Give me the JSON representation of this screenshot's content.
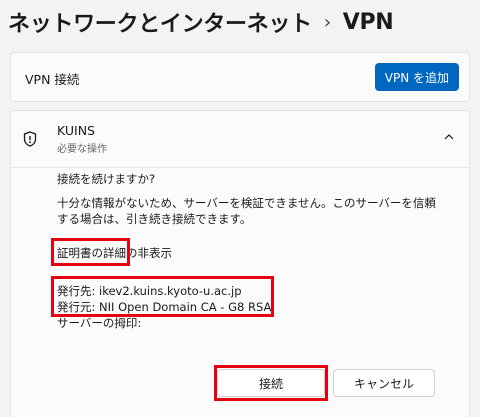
{
  "breadcrumb": {
    "parent": "ネットワークとインターネット",
    "separator": "›",
    "current": "VPN"
  },
  "vpn_section": {
    "label": "VPN 接続",
    "add_button": "VPN を追加"
  },
  "connection": {
    "name": "KUINS",
    "status": "必要な操作",
    "prompt": "接続を続けますか?",
    "message": "十分な情報がないため、サーバーを検証できません。このサーバーを信頼する場合は、引き続き接続できます。",
    "details_toggle": "証明書の詳細の非表示",
    "issued_to": "発行先: ikev2.kuins.kyoto-u.ac.jp",
    "issued_by": "発行元: NII Open Domain CA - G8 RSA",
    "thumbprint": "サーバーの拇印:",
    "connect_button": "接続",
    "cancel_button": "キャンセル"
  },
  "colors": {
    "accent": "#0067c0",
    "highlight": "#e60012"
  }
}
